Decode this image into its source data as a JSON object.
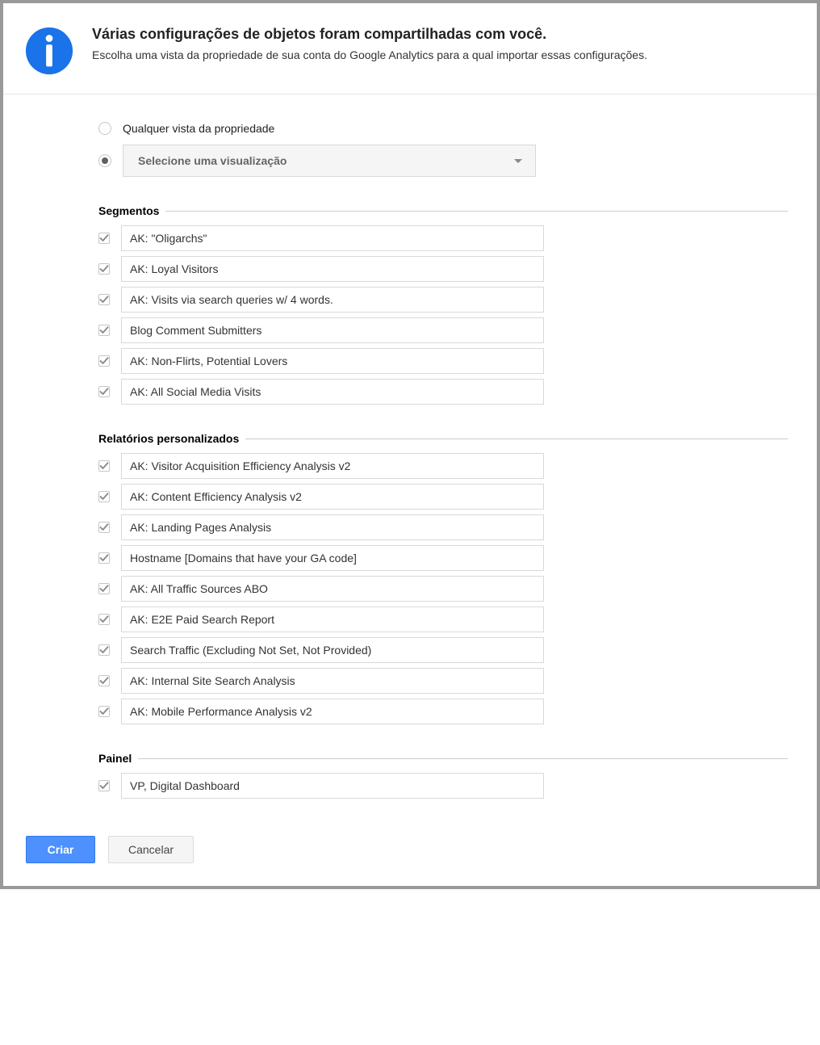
{
  "header": {
    "title": "Várias configurações de objetos foram compartilhadas com você.",
    "subtitle": "Escolha uma vista da propriedade de sua conta do Google Analytics para a qual importar essas configurações."
  },
  "view_selection": {
    "option_any": "Qualquer vista da propriedade",
    "select_placeholder": "Selecione uma visualização"
  },
  "sections": [
    {
      "title": "Segmentos",
      "items": [
        "AK: \"Oligarchs\"",
        "AK: Loyal Visitors",
        "AK: Visits via search queries w/ 4 words.",
        "Blog Comment Submitters",
        "AK: Non-Flirts, Potential Lovers",
        "AK: All Social Media Visits"
      ]
    },
    {
      "title": "Relatórios personalizados",
      "items": [
        "AK: Visitor Acquisition Efficiency Analysis v2",
        "AK: Content Efficiency Analysis v2",
        "AK: Landing Pages Analysis",
        "Hostname [Domains that have your GA code]",
        "AK: All Traffic Sources ABO",
        "AK: E2E Paid Search Report",
        "Search Traffic (Excluding Not Set, Not Provided)",
        "AK: Internal Site Search Analysis",
        "AK: Mobile Performance Analysis v2"
      ]
    },
    {
      "title": "Painel",
      "items": [
        "VP, Digital Dashboard"
      ]
    }
  ],
  "buttons": {
    "create": "Criar",
    "cancel": "Cancelar"
  }
}
